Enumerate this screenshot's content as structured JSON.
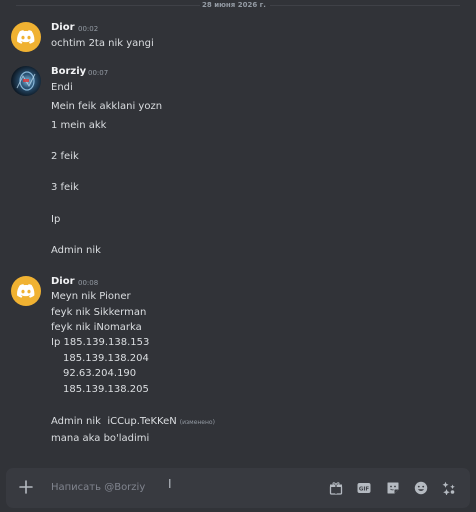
{
  "date_divider": "28 июня 2026 г.",
  "messages": [
    {
      "author": "Dior",
      "time": "00:02",
      "lines": [
        "ochtim 2ta nik yangi"
      ]
    },
    {
      "author": "Borziy",
      "time": "00:07",
      "lines": [
        "Endi",
        "Mein feik akklani yozn",
        "1 mein akk",
        "2 feik",
        "3 feik",
        "Ip",
        "Admin nik"
      ]
    },
    {
      "author": "Dior",
      "time": "00:08",
      "lines": [
        "Meyn nik Pioner",
        "feyk nik Sikkerman",
        "feyk nik iNomarka",
        "Ip 185.139.138.153",
        "185.139.138.204",
        "92.63.204.190",
        "185.139.138.205",
        "Admin nik  iCCup.TeKKeN",
        "mana aka bo'ladimi"
      ],
      "edited_label": "(изменено)"
    }
  ],
  "composer": {
    "placeholder": "Написать @Borziy"
  },
  "colors": {
    "background": "#313338",
    "composer": "#383a40",
    "discord_avatar": "#f0b232"
  },
  "icons": [
    "plus-icon",
    "gift-icon",
    "gif-icon",
    "sticker-icon",
    "emoji-icon",
    "apps-icon"
  ]
}
